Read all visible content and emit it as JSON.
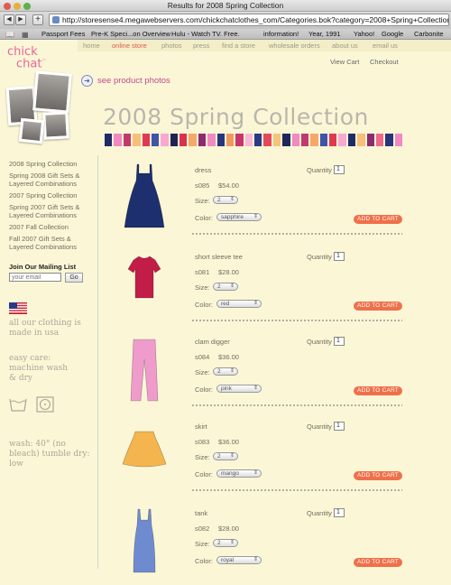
{
  "browser": {
    "window_title": "Results for 2008 Spring Collection",
    "url": "http://storesense4.megawebservers.com/chickchatclothes_com/Categories.bok?category=2008+Spring+Collection",
    "bookmarks": [
      "Passport Fees",
      "Pre-K Speci...on Overview",
      "Hulu - Watch TV. Free.",
      "information!",
      "Year, 1991",
      "Yahoo!",
      "Google",
      "Carbonite"
    ]
  },
  "site_nav": [
    "home",
    "online store",
    "photos",
    "press",
    "find a store",
    "wholesale orders",
    "about us",
    "email us"
  ],
  "site_nav_active": "online store",
  "logo": {
    "line1": "chick",
    "line2": "chat",
    "tm": "™"
  },
  "header": {
    "view_cart": "View Cart",
    "checkout": "Checkout",
    "see_photos": "see product photos"
  },
  "collection_title": "2008 Spring Collection",
  "stripe_colors": [
    "#1f2b66",
    "#f08ac0",
    "#c13a6a",
    "#f6c07a",
    "#e03a52",
    "#3f55a8",
    "#f9a8d0",
    "#1e2452",
    "#d9324e",
    "#f6a86a",
    "#8b2c6f",
    "#f08ac0",
    "#26357c",
    "#ef9a5c",
    "#c7356c",
    "#f9b8d8",
    "#2b3a86",
    "#e24a5a",
    "#f5c47d",
    "#20275c",
    "#f08ac0",
    "#c13a6a",
    "#f6a86a",
    "#3f55a8",
    "#e03a52",
    "#f9a8d0",
    "#1f2b66",
    "#f6c07a",
    "#8b2c6f",
    "#ef6a8a",
    "#26357c",
    "#f08ac0"
  ],
  "sidebar": {
    "links": [
      "2008 Spring Collection",
      "Spring 2008 Gift Sets & Layered Combinations",
      "2007 Spring Collection",
      "Spring 2007 Gift Sets & Layered Combinations",
      "2007 Fall Collection",
      "Fall 2007 Gift Sets & Layered Combinations"
    ],
    "mailing_heading": "Join Our Mailing List",
    "email_placeholder": "your email",
    "go": "Go",
    "made_in_usa": "all our clothing is made in usa",
    "easy_care": "easy care: machine wash & dry",
    "wash": "wash: 40° (no bleach) tumble dry: low"
  },
  "labels": {
    "quantity": "Quantity",
    "size": "Size:",
    "color": "Color:",
    "add_to_cart": "ADD TO CART"
  },
  "products": [
    {
      "name": "dress",
      "sku": "s085",
      "price": "$54.00",
      "qty": "1",
      "size": "2",
      "color": "sapphire",
      "icon": "dress-icon",
      "fill": "#1d2f6e"
    },
    {
      "name": "short sleeve tee",
      "sku": "s081",
      "price": "$28.00",
      "qty": "1",
      "size": "2",
      "color": "red",
      "icon": "tee-icon",
      "fill": "#c21c48"
    },
    {
      "name": "clam digger",
      "sku": "s084",
      "price": "$36.00",
      "qty": "1",
      "size": "2",
      "color": "pink",
      "icon": "pants-icon",
      "fill": "#ef9ccc"
    },
    {
      "name": "skirt",
      "sku": "s083",
      "price": "$36.00",
      "qty": "1",
      "size": "2",
      "color": "mango",
      "icon": "skirt-icon",
      "fill": "#f4b54e"
    },
    {
      "name": "tank",
      "sku": "s082",
      "price": "$28.00",
      "qty": "1",
      "size": "2",
      "color": "royal",
      "icon": "tank-icon",
      "fill": "#6f8bd0"
    }
  ]
}
